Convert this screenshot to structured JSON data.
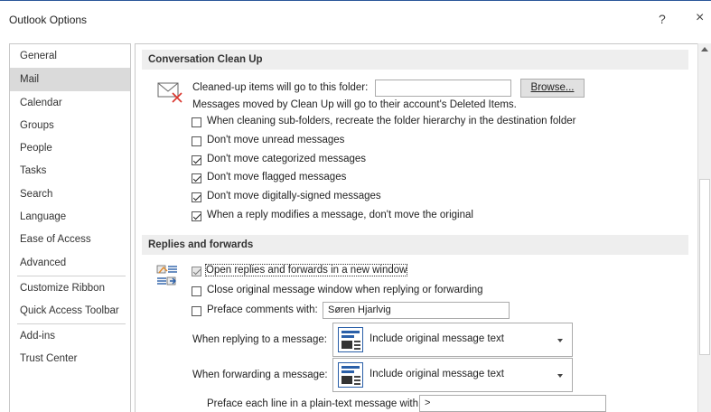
{
  "window": {
    "title": "Outlook Options",
    "help": "?",
    "close": "×"
  },
  "sidebar": {
    "items": [
      {
        "label": "General"
      },
      {
        "label": "Mail"
      },
      {
        "label": "Calendar"
      },
      {
        "label": "Groups"
      },
      {
        "label": "People"
      },
      {
        "label": "Tasks"
      },
      {
        "label": "Search"
      },
      {
        "label": "Language"
      },
      {
        "label": "Ease of Access"
      },
      {
        "label": "Advanced"
      },
      {
        "label": "Customize Ribbon"
      },
      {
        "label": "Quick Access Toolbar"
      },
      {
        "label": "Add-ins"
      },
      {
        "label": "Trust Center"
      }
    ],
    "active": "Mail"
  },
  "conversation": {
    "header": "Conversation Clean Up",
    "folder_label": "Cleaned-up items will go to this folder:",
    "folder_value": "",
    "browse": "Browse...",
    "note": "Messages moved by Clean Up will go to their account's Deleted Items.",
    "options": [
      {
        "label": "When cleaning sub-folders, recreate the folder hierarchy in the destination folder",
        "checked": false
      },
      {
        "label": "Don't move unread messages",
        "checked": false
      },
      {
        "label": "Don't move categorized messages",
        "checked": true
      },
      {
        "label": "Don't move flagged messages",
        "checked": true
      },
      {
        "label": "Don't move digitally-signed messages",
        "checked": true
      },
      {
        "label": "When a reply modifies a message, don't move the original",
        "checked": true
      }
    ]
  },
  "replies": {
    "header": "Replies and forwards",
    "open_new_window": {
      "label": "Open replies and forwards in a new window",
      "checked": true
    },
    "close_original": {
      "label": "Close original message window when replying or forwarding",
      "checked": false
    },
    "preface": {
      "label": "Preface comments with:",
      "checked": false,
      "value": "Søren Hjarlvig"
    },
    "when_replying": {
      "label": "When replying to a message:",
      "value": "Include original message text"
    },
    "when_forwarding": {
      "label": "When forwarding a message:",
      "value": "Include original message text"
    },
    "preface_line": {
      "label": "Preface each line in a plain-text message with:",
      "value": ">"
    }
  }
}
